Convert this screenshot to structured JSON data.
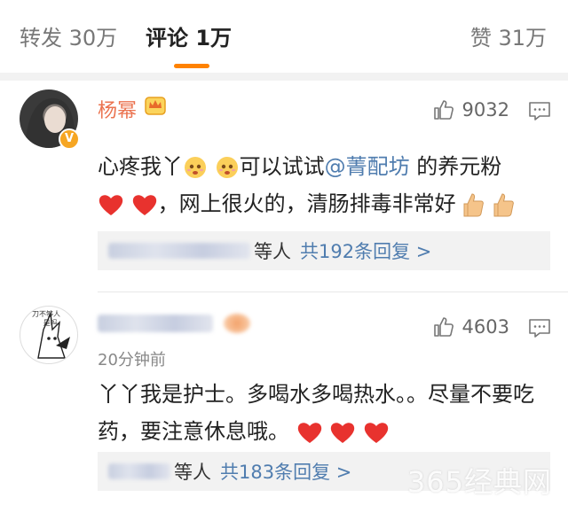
{
  "tabs": {
    "repost": "转发 30万",
    "comment": "评论 1万",
    "like": "赞 31万"
  },
  "comments": [
    {
      "username": "杨幂",
      "likes": "9032",
      "text_part1": "心疼我丫",
      "text_part2": "可以试试",
      "mention": "@菁配坊",
      "text_part3": " 的养元粉",
      "text_part4": "，网上很火的，清肠排毒非常好",
      "reply_people": "等人",
      "reply_count": "共192条回复 >"
    },
    {
      "username_blurred": true,
      "likes": "4603",
      "timestamp": "20分钟前",
      "avatar_text": "刀不够人\n是吗",
      "text": "丫丫我是护士。多喝水多喝热水。。尽量不要吃药，要注意休息哦。",
      "reply_people": "等人",
      "reply_count": "共183条回复 >"
    }
  ],
  "watermark": "365经典网",
  "colors": {
    "accent_orange": "#ff8200",
    "link_blue": "#507daf",
    "username_orange": "#eb7350",
    "heart_red": "#e8322e"
  }
}
